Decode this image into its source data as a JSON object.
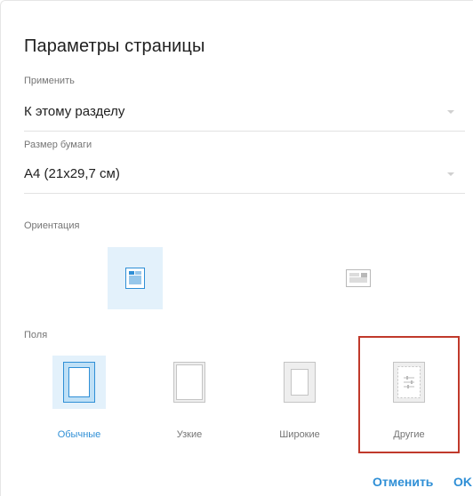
{
  "dialog": {
    "title": "Параметры страницы",
    "apply": {
      "caption": "Применить",
      "value": "К этому разделу"
    },
    "paper_size": {
      "caption": "Размер бумаги",
      "value": "А4 (21х29,7 см)"
    },
    "orientation": {
      "caption": "Ориентация",
      "options": [
        {
          "icon": "portrait-page-icon",
          "selected": true
        },
        {
          "icon": "landscape-page-icon",
          "selected": false
        }
      ]
    },
    "margins": {
      "caption": "Поля",
      "options": [
        {
          "label": "Обычные",
          "icon": "normal-margins-icon",
          "selected": true
        },
        {
          "label": "Узкие",
          "icon": "narrow-margins-icon",
          "selected": false
        },
        {
          "label": "Широкие",
          "icon": "wide-margins-icon",
          "selected": false
        },
        {
          "label": "Другие",
          "icon": "custom-margins-icon",
          "selected": false
        }
      ]
    },
    "buttons": {
      "cancel": "Отменить",
      "ok": "OK"
    },
    "colors": {
      "accent": "#2f8fd6",
      "selected_bg": "#e3f1fb",
      "highlight": "#c0392b"
    }
  }
}
